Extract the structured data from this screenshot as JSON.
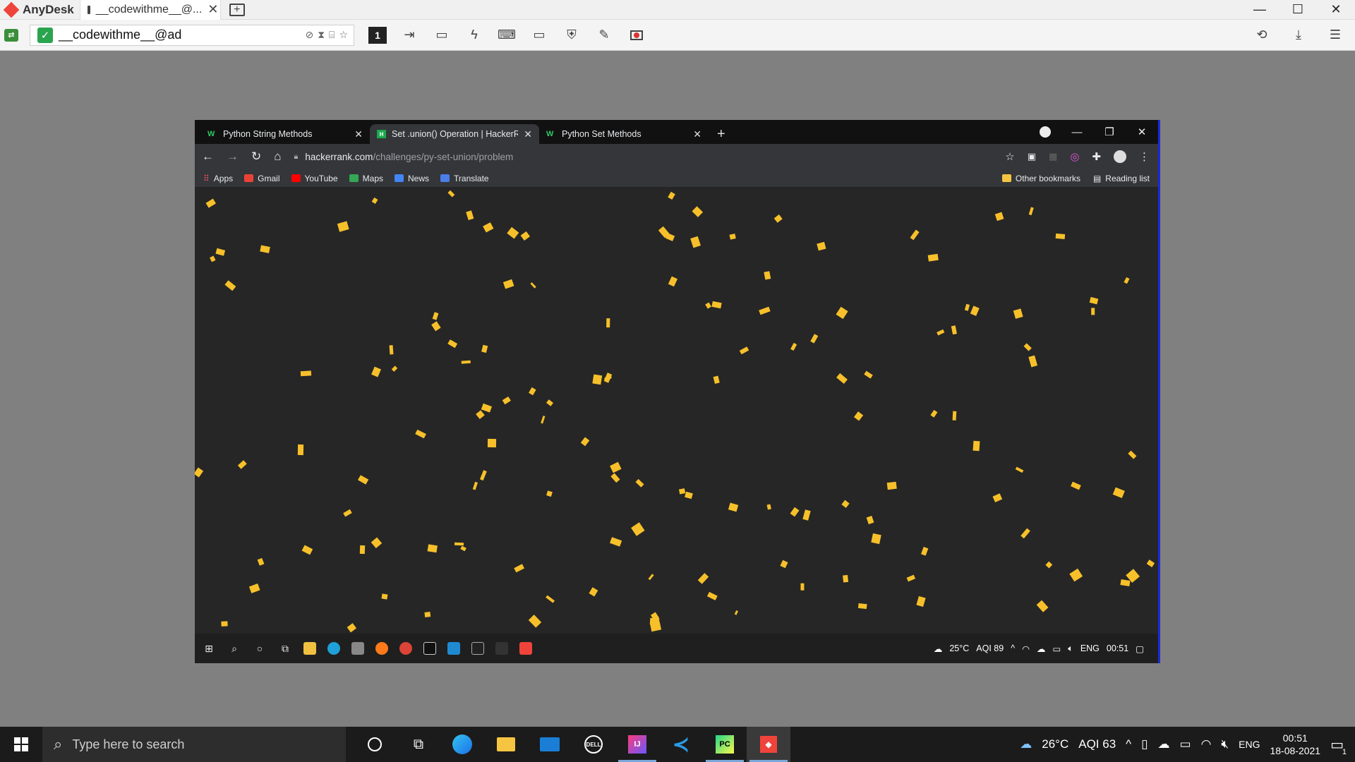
{
  "anydesk": {
    "app_name": "AnyDesk",
    "tab_title": "__codewithme__@...",
    "address": "__codewithme__@ad",
    "monitor_number": "1"
  },
  "remote": {
    "tabs": [
      {
        "label": "Python String Methods",
        "favicon": "W"
      },
      {
        "label": "Set .union() Operation | HackerR...",
        "favicon": "H"
      },
      {
        "label": "Python Set Methods",
        "favicon": "W"
      }
    ],
    "url_domain": "hackerrank.com",
    "url_path": "/challenges/py-set-union/problem",
    "bookmarks": [
      "Apps",
      "Gmail",
      "YouTube",
      "Maps",
      "News",
      "Translate"
    ],
    "bookmarks_right": [
      "Other bookmarks",
      "Reading list"
    ],
    "taskbar": {
      "weather": "25°C",
      "aqi": "AQI 89",
      "lang": "ENG",
      "time": "00:51"
    }
  },
  "taskbar": {
    "search_placeholder": "Type here to search",
    "weather": "26°C",
    "aqi": "AQI 63",
    "lang": "ENG",
    "time": "00:51",
    "date": "18-08-2021",
    "notifications": "1"
  },
  "colors": {
    "confetti": "#f7c02a",
    "anydesk_red": "#ef443b"
  }
}
